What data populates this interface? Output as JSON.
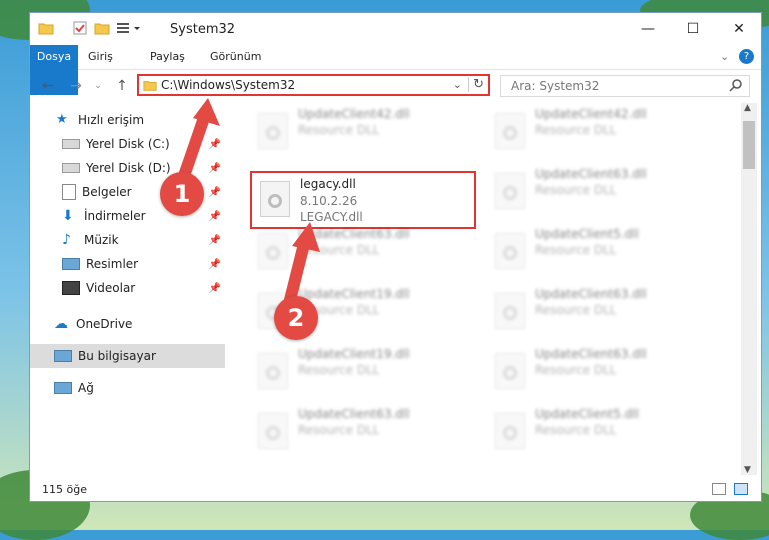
{
  "window": {
    "title": "System32",
    "tabs": [
      {
        "label": "Dosya"
      },
      {
        "label": "Giriş"
      },
      {
        "label": "Paylaş"
      },
      {
        "label": "Görünüm"
      }
    ]
  },
  "navigation": {
    "address": "C:\\Windows\\System32",
    "search_placeholder": "Ara: System32"
  },
  "sidebar": {
    "items": [
      {
        "label": "Hızlı erişim",
        "icon": "star-icon"
      },
      {
        "label": "Yerel Disk (C:)",
        "icon": "drive-icon"
      },
      {
        "label": "Yerel Disk (D:)",
        "icon": "drive-icon"
      },
      {
        "label": "Belgeler",
        "icon": "documents-icon"
      },
      {
        "label": "İndirmeler",
        "icon": "download-icon"
      },
      {
        "label": "Müzik",
        "icon": "music-icon"
      },
      {
        "label": "Resimler",
        "icon": "pictures-icon"
      },
      {
        "label": "Videolar",
        "icon": "video-icon"
      },
      {
        "label": "OneDrive",
        "icon": "cloud-icon"
      },
      {
        "label": "Bu bilgisayar",
        "icon": "computer-icon"
      },
      {
        "label": "Ağ",
        "icon": "network-icon"
      }
    ]
  },
  "files": [
    {
      "name": "UpdateClient42.dll",
      "type": "Resource DLL"
    },
    {
      "name": "UpdateClient42.dll",
      "type": "Resource DLL"
    },
    {
      "name": "legacy.dll",
      "version": "8.10.2.26",
      "desc": "LEGACY.dll"
    },
    {
      "name": "UpdateClient63.dll",
      "type": "Resource DLL"
    },
    {
      "name": "UpdateClient63.dll",
      "type": "Resource DLL"
    },
    {
      "name": "UpdateClient5.dll",
      "type": "Resource DLL"
    },
    {
      "name": "UpdateClient19.dll",
      "type": "Resource DLL"
    },
    {
      "name": "UpdateClient63.dll",
      "type": "Resource DLL"
    },
    {
      "name": "UpdateClient19.dll",
      "type": "Resource DLL"
    },
    {
      "name": "UpdateClient63.dll",
      "type": "Resource DLL"
    },
    {
      "name": "UpdateClient63.dll",
      "type": "Resource DLL"
    },
    {
      "name": "UpdateClient5.dll",
      "type": "Resource DLL"
    }
  ],
  "status": {
    "count": "115 öğe"
  },
  "annotations": {
    "step1": "1",
    "step2": "2"
  },
  "colors": {
    "accent": "#1979ca",
    "highlight": "#e0362f",
    "badge": "#e24a43"
  }
}
